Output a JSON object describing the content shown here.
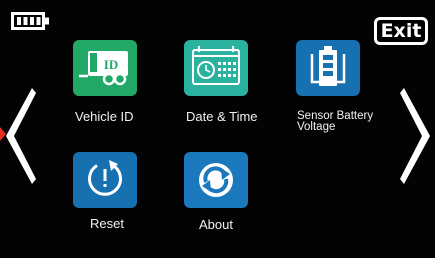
{
  "status_bar": {
    "battery_icon": "battery-full-icon"
  },
  "header": {
    "exit_label": "Exit"
  },
  "navigation": {
    "prev_icon": "chevron-left-icon",
    "next_icon": "chevron-right-icon"
  },
  "menu": {
    "items": [
      {
        "label": "Vehicle ID",
        "icon": "trailer-id-icon",
        "color": "#23a967",
        "badge": "ID"
      },
      {
        "label": "Date & Time",
        "icon": "calendar-clock-icon",
        "color": "#2bb29e"
      },
      {
        "label_lines": [
          "Sensor Battery",
          "Voltage"
        ],
        "icon": "sensor-battery-icon",
        "color": "#1771b0"
      },
      {
        "label": "Reset",
        "icon": "reset-icon",
        "color": "#1771b0"
      },
      {
        "label": "About",
        "icon": "about-refresh-icon",
        "color": "#1a79bc"
      }
    ]
  },
  "colors": {
    "background": "#030303",
    "foreground": "#ffffff",
    "edge_marker": "#e0301e"
  }
}
